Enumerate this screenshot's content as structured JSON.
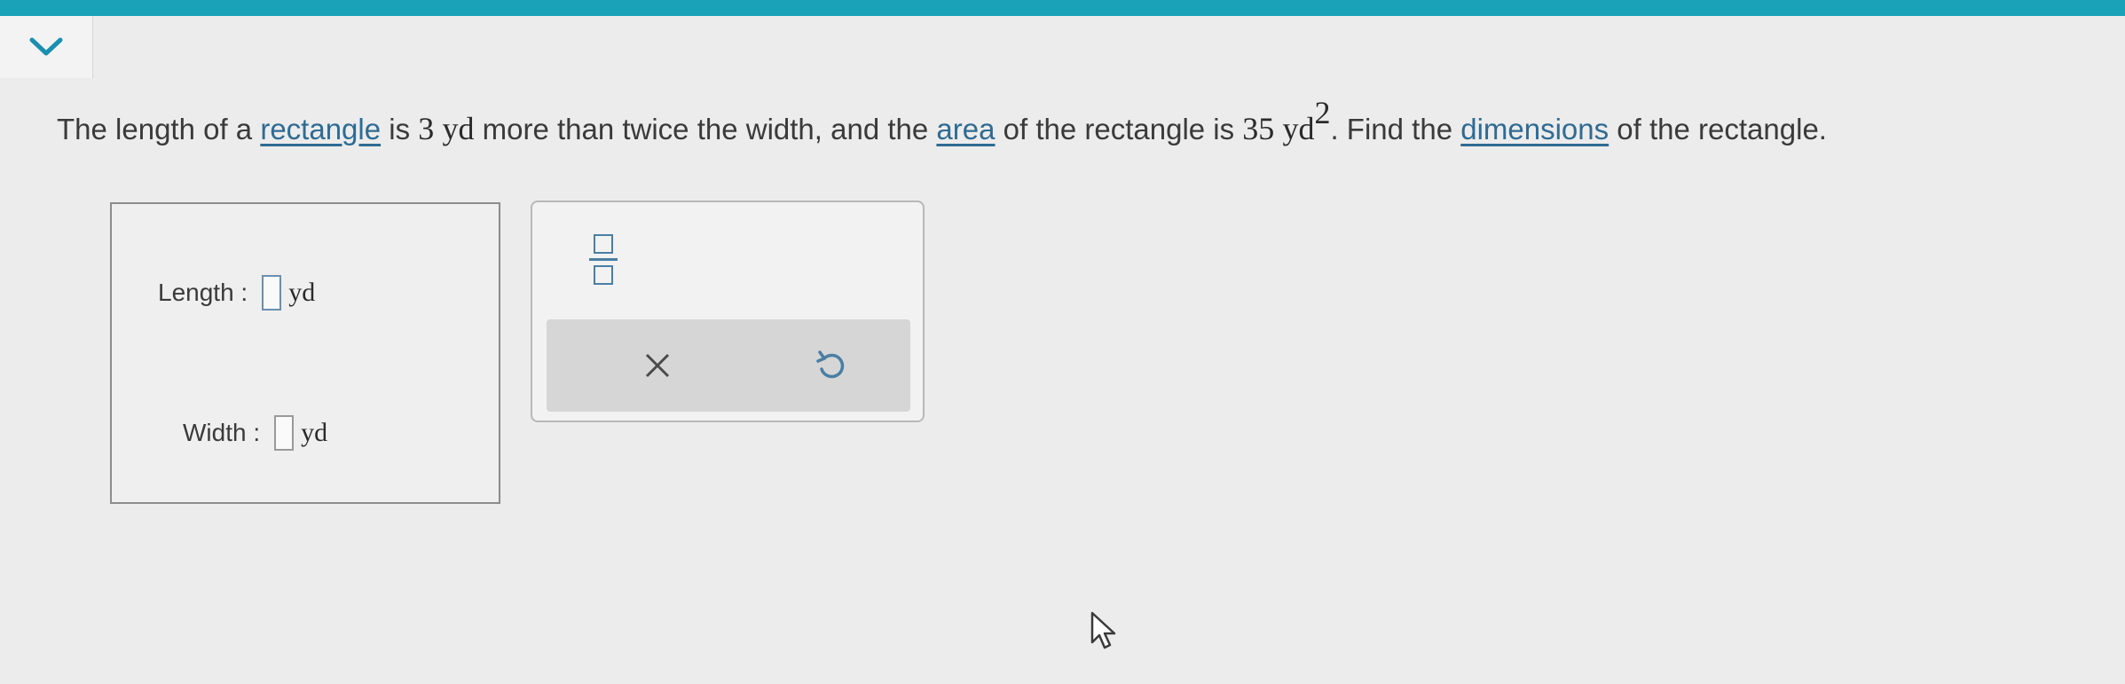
{
  "question": {
    "part1": "The length of a ",
    "link1": "rectangle",
    "part2": " is ",
    "num1": "3",
    "unit1": "yd",
    "part3": " more than twice the width, and the ",
    "link2": "area",
    "part4": " of the rectangle is ",
    "num2": "35",
    "unit2": "yd",
    "exponent": "2",
    "part5": ". Find the ",
    "link3": "dimensions",
    "part6": " of the rectangle."
  },
  "answer": {
    "length_label": "Length :",
    "length_unit": "yd",
    "length_value": "",
    "width_label": "Width :",
    "width_unit": "yd",
    "width_value": ""
  },
  "icons": {
    "collapse": "chevron-down-icon",
    "fraction": "fraction-template-icon",
    "clear": "close-icon",
    "undo": "undo-icon",
    "cursor": "mouse-pointer-icon"
  },
  "colors": {
    "top_bar": "#1aa2b8",
    "link": "#2f6b93",
    "icon_blue": "#4a7ea3"
  }
}
